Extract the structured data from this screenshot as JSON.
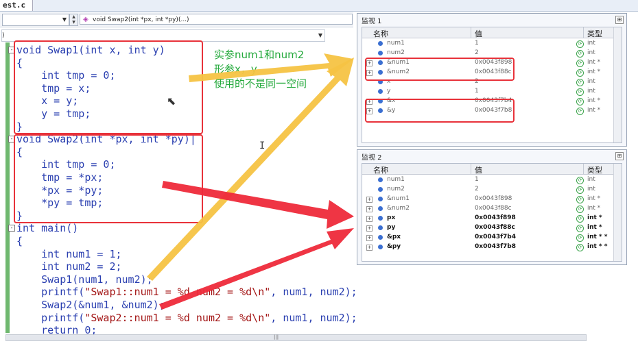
{
  "tab": {
    "label": "est.c"
  },
  "nav": {
    "scope_dropdown": "",
    "function_dropdown": "void Swap2(int *px, int *py)(...)",
    "second_dropdown": ")"
  },
  "code": [
    {
      "text": "void Swap1(int x, int y)",
      "fold": "-"
    },
    {
      "text": "{",
      "fold": ""
    },
    {
      "text": "    int tmp = 0;",
      "fold": ""
    },
    {
      "text": "    tmp = x;",
      "fold": ""
    },
    {
      "text": "    x = y;",
      "fold": ""
    },
    {
      "text": "    y = tmp;",
      "fold": ""
    },
    {
      "text": "}",
      "fold": ""
    },
    {
      "text": "void Swap2(int *px, int *py)|",
      "fold": "-"
    },
    {
      "text": "{",
      "fold": ""
    },
    {
      "text": "    int tmp = 0;",
      "fold": ""
    },
    {
      "text": "    tmp = *px;",
      "fold": ""
    },
    {
      "text": "    *px = *py;",
      "fold": ""
    },
    {
      "text": "    *py = tmp;",
      "fold": ""
    },
    {
      "text": "}",
      "fold": ""
    },
    {
      "text": "int main()",
      "fold": "-"
    },
    {
      "text": "{",
      "fold": ""
    },
    {
      "text": "    int num1 = 1;",
      "fold": ""
    },
    {
      "text": "    int num2 = 2;",
      "fold": ""
    },
    {
      "text": "    Swap1(num1, num2);",
      "fold": ""
    },
    {
      "text": "    printf(\"Swap1::num1 = %d num2 = %d\\n\", num1, num2);",
      "fold": ""
    },
    {
      "text": "    Swap2(&num1, &num2);",
      "fold": ""
    },
    {
      "text": "    printf(\"Swap2::num1 = %d num2 = %d\\n\", num1, num2);",
      "fold": ""
    },
    {
      "text": "    return 0;",
      "fold": ""
    }
  ],
  "annotation": {
    "line1": "实参num1和num2",
    "line2": "形参x，y",
    "line3": "使用的不是同一空间"
  },
  "watch1": {
    "title": "监视 1",
    "close": "⊞",
    "headers": {
      "name": "名称",
      "value": "值",
      "type": "类型"
    },
    "rows": [
      {
        "expand": "",
        "name": "num1",
        "value": "1",
        "type": "int"
      },
      {
        "expand": "",
        "name": "num2",
        "value": "2",
        "type": "int"
      },
      {
        "expand": "+",
        "name": "&num1",
        "value": "0x0043f898",
        "type": "int *"
      },
      {
        "expand": "+",
        "name": "&num2",
        "value": "0x0043f88c",
        "type": "int *"
      },
      {
        "expand": "",
        "name": "x",
        "value": "2",
        "type": "int"
      },
      {
        "expand": "",
        "name": "y",
        "value": "1",
        "type": "int"
      },
      {
        "expand": "+",
        "name": "&x",
        "value": "0x0043f7b4",
        "type": "int *"
      },
      {
        "expand": "+",
        "name": "&y",
        "value": "0x0043f7b8",
        "type": "int *"
      }
    ]
  },
  "watch2": {
    "title": "监视 2",
    "close": "⊞",
    "headers": {
      "name": "名称",
      "value": "值",
      "type": "类型"
    },
    "rows": [
      {
        "expand": "",
        "name": "num1",
        "value": "1",
        "type": "int",
        "bold": false
      },
      {
        "expand": "",
        "name": "num2",
        "value": "2",
        "type": "int",
        "bold": false
      },
      {
        "expand": "+",
        "name": "&num1",
        "value": "0x0043f898",
        "type": "int *",
        "bold": false
      },
      {
        "expand": "+",
        "name": "&num2",
        "value": "0x0043f88c",
        "type": "int *",
        "bold": false
      },
      {
        "expand": "+",
        "name": "px",
        "value": "0x0043f898",
        "type": "int *",
        "bold": true
      },
      {
        "expand": "+",
        "name": "py",
        "value": "0x0043f88c",
        "type": "int *",
        "bold": true
      },
      {
        "expand": "+",
        "name": "&px",
        "value": "0x0043f7b4",
        "type": "int * *",
        "bold": true
      },
      {
        "expand": "+",
        "name": "&py",
        "value": "0x0043f7b8",
        "type": "int * *",
        "bold": true
      }
    ]
  },
  "colors": {
    "keyword": "#2a3fb0",
    "string": "#a31515",
    "highlight_box": "#e8323a",
    "arrow_yellow": "#f6c343",
    "arrow_red": "#ee2a3a",
    "annotation": "#22a83a"
  }
}
